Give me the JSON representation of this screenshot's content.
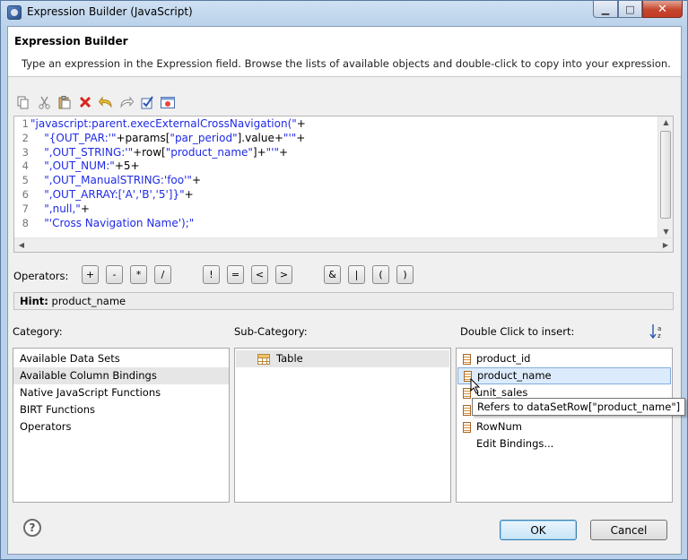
{
  "window": {
    "title": "Expression Builder (JavaScript)",
    "minimize": "▁",
    "maximize": "□",
    "close": "✕"
  },
  "header": {
    "title": "Expression Builder",
    "description": "Type an expression in the Expression field. Browse the lists of available objects and double-click to copy into your expression."
  },
  "toolbar": {
    "icons": [
      "copy-icon",
      "cut-icon",
      "paste-icon",
      "delete-icon",
      "undo-icon",
      "redo-icon",
      "validate-icon",
      "clear-icon"
    ]
  },
  "editor": {
    "line_numbers": [
      "1",
      "2",
      "3",
      "4",
      "5",
      "6",
      "7",
      "8"
    ],
    "lines": [
      [
        {
          "t": "\"javascript:parent.execExternalCrossNavigation(\"",
          "s": 1
        },
        {
          "t": "+",
          "s": 0
        }
      ],
      [
        {
          "t": "    \"{OUT_PAR:'\"",
          "s": 1
        },
        {
          "t": "+params[",
          "s": 0
        },
        {
          "t": "\"par_period\"",
          "s": 1
        },
        {
          "t": "].value+",
          "s": 0
        },
        {
          "t": "\"'\"",
          "s": 1
        },
        {
          "t": "+",
          "s": 0
        }
      ],
      [
        {
          "t": "    \",OUT_STRING:'\"",
          "s": 1
        },
        {
          "t": "+row[",
          "s": 0
        },
        {
          "t": "\"product_name\"",
          "s": 1
        },
        {
          "t": "]+",
          "s": 0
        },
        {
          "t": "\"'\"",
          "s": 1
        },
        {
          "t": "+",
          "s": 0
        }
      ],
      [
        {
          "t": "    \",OUT_NUM:\"",
          "s": 1
        },
        {
          "t": "+5+",
          "s": 0
        }
      ],
      [
        {
          "t": "    \",OUT_ManualSTRING:'foo'\"",
          "s": 1
        },
        {
          "t": "+",
          "s": 0
        }
      ],
      [
        {
          "t": "    \",OUT_ARRAY:['A','B','5']}\"",
          "s": 1
        },
        {
          "t": "+",
          "s": 0
        }
      ],
      [
        {
          "t": "    \",null,\"",
          "s": 1
        },
        {
          "t": "+",
          "s": 0
        }
      ],
      [
        {
          "t": "    \"'Cross Navigation Name');\"",
          "s": 1
        }
      ]
    ]
  },
  "operators": {
    "label": "Operators:",
    "items": [
      "+",
      "-",
      "*",
      "/",
      "!",
      "=",
      "<",
      ">",
      "&",
      "|",
      "(",
      ")"
    ]
  },
  "hint": {
    "label": "Hint:",
    "value": "product_name"
  },
  "category": {
    "label": "Category:",
    "items": [
      "Available Data Sets",
      "Available Column Bindings",
      "Native JavaScript Functions",
      "BIRT Functions",
      "Operators"
    ],
    "selected_index": 1
  },
  "subcategory": {
    "label": "Sub-Category:",
    "items": [
      "Table"
    ]
  },
  "insert": {
    "label": "Double Click to insert:",
    "items": [
      "product_id",
      "product_name",
      "unit_sales",
      "",
      "RowNum",
      "Edit Bindings..."
    ],
    "selected_index": 1
  },
  "tooltip": {
    "text": "Refers to dataSetRow[\"product_name\"]"
  },
  "buttons": {
    "ok": "OK",
    "cancel": "Cancel",
    "help": "?"
  }
}
